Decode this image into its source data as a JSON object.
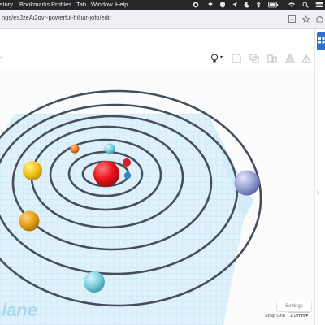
{
  "menubar": {
    "items": [
      "istory",
      "Bookmarks",
      "Profiles",
      "Tab",
      "Window",
      "Help"
    ]
  },
  "browser": {
    "url": "ngs/esJzeAi2qvr-powerful-hilliar-jofo/edit"
  },
  "toolbar": {
    "icons": [
      "lightbulb-icon",
      "note-icon",
      "group-icon",
      "align-icon",
      "mirror-icon",
      "flip-icon"
    ]
  },
  "scene": {
    "orbit_color": "#454f5b",
    "grid_color": "#cfe9f7",
    "workplane_label": "lane",
    "planets": [
      {
        "name": "sun",
        "color": "#e8141b"
      },
      {
        "name": "mercury",
        "color": "#d81e2a"
      },
      {
        "name": "venus",
        "color": "#2f88c7"
      },
      {
        "name": "earth",
        "color": "#7fd0df"
      },
      {
        "name": "mars",
        "color": "#ec7d22"
      },
      {
        "name": "jupiter",
        "color": "#f2c519"
      },
      {
        "name": "saturn",
        "color": "#e5a21c"
      },
      {
        "name": "uranus",
        "color": "#86cdd8"
      },
      {
        "name": "neptune",
        "color": "#9aa3d6"
      }
    ]
  },
  "footer": {
    "settings_label": "Settings",
    "snap_label": "Snap Grid",
    "snap_value": "1.0 mm"
  }
}
